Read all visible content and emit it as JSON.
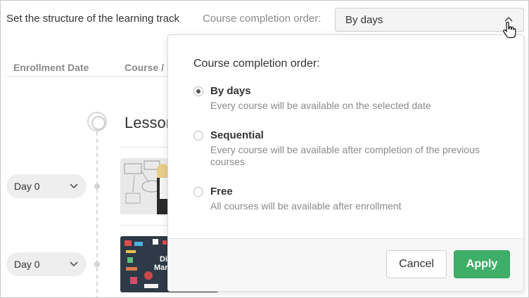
{
  "header": {
    "title": "Set the structure of the learning track",
    "order_label": "Course completion order:",
    "order_value": "By days"
  },
  "table": {
    "col_enrollment": "Enrollment Date",
    "col_course": "Course / S"
  },
  "timeline": {
    "lesson_title": "Lessor",
    "rows": [
      {
        "day": "Day 0"
      },
      {
        "day": "Day 0"
      }
    ],
    "thumb2_text": [
      "Di",
      "Mark"
    ]
  },
  "popover": {
    "heading": "Course completion order:",
    "options": [
      {
        "title": "By days",
        "description": "Every course will be available on the selected date",
        "checked": true
      },
      {
        "title": "Sequential",
        "description": "Every course will be available after completion of the previous courses",
        "checked": false
      },
      {
        "title": "Free",
        "description": "All courses will be available after enrollment",
        "checked": false
      }
    ],
    "cancel_label": "Cancel",
    "apply_label": "Apply"
  },
  "colors": {
    "accent_green": "#3fae68",
    "muted_text": "#8a8a8a"
  },
  "icons": {
    "select_chevron": "chevron-up-icon",
    "cursor": "hand-pointer-icon",
    "day_chevron": "chevron-down-icon"
  }
}
